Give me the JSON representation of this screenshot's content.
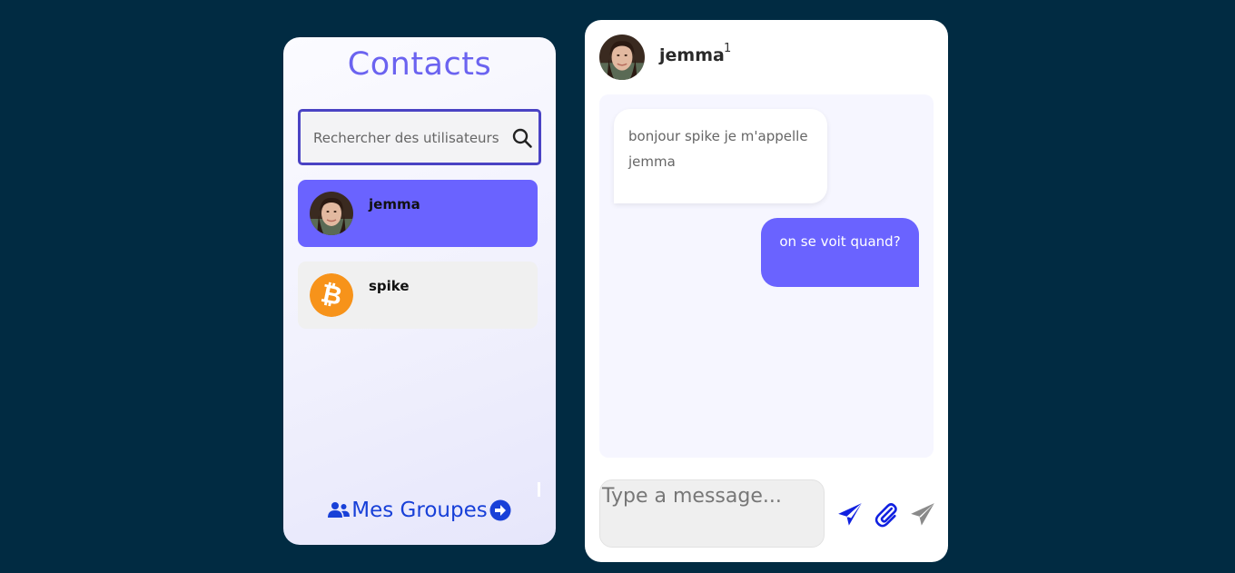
{
  "contacts_panel": {
    "title": "Contacts",
    "search": {
      "placeholder": "Rechercher des utilisateurs",
      "value": ""
    },
    "items": [
      {
        "name": "jemma",
        "avatar": "woman-portrait-avatar",
        "active": true
      },
      {
        "name": "spike",
        "avatar": "bitcoin-logo-avatar",
        "active": false
      }
    ],
    "groups_link": {
      "label": "Mes Groupes",
      "left_icon": "users-icon",
      "right_icon": "arrow-circle-right-icon"
    }
  },
  "chat_panel": {
    "header": {
      "name": "jemma",
      "badge": "1",
      "avatar": "woman-portrait-avatar"
    },
    "messages": [
      {
        "direction": "incoming",
        "text": "bonjour spike je m'appelle jemma"
      },
      {
        "direction": "outgoing",
        "text": "on se voit quand?"
      }
    ],
    "composer": {
      "placeholder": "Type a message...",
      "value": ""
    },
    "actions": [
      "send-icon",
      "paperclip-icon",
      "send-gray-icon"
    ]
  },
  "colors": {
    "background": "#012b42",
    "accent": "#6a63ff",
    "title": "#6b63f0",
    "link_blue": "#1840d8",
    "search_border": "#4a43c4"
  }
}
